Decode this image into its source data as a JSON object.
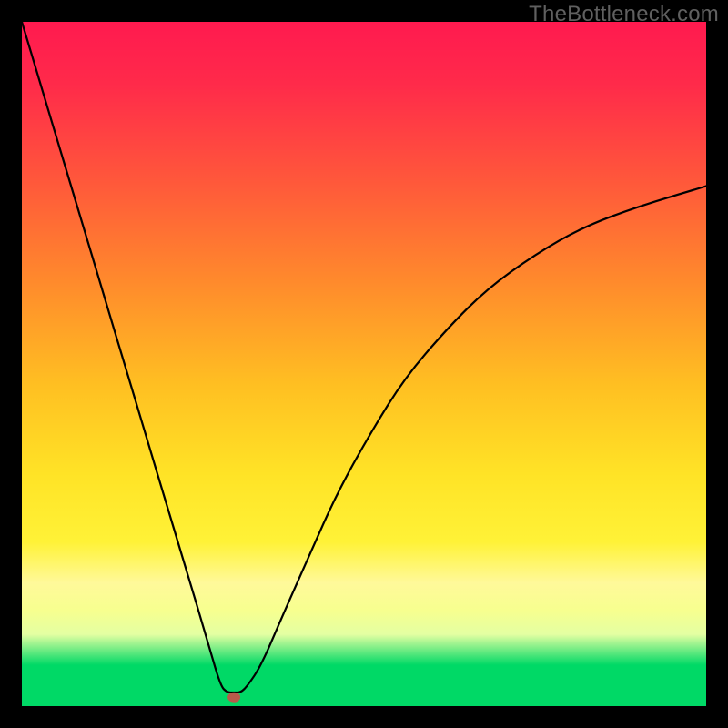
{
  "watermark": "TheBottleneck.com",
  "chart_data": {
    "type": "line",
    "title": "",
    "xlabel": "",
    "ylabel": "",
    "xlim": [
      0,
      100
    ],
    "ylim": [
      0,
      100
    ],
    "grid": false,
    "legend": false,
    "colors": {
      "curve": "#000000",
      "marker": "#b85a4a",
      "background_top": "#ff1a4f",
      "background_mid_orange": "#ff8a2c",
      "background_mid_yellow": "#ffe326",
      "background_pale_band": "#fff99a",
      "background_bottom": "#00d966"
    },
    "series": [
      {
        "name": "curve",
        "x": [
          0,
          3,
          6,
          9,
          12,
          15,
          18,
          21,
          24,
          27,
          29,
          30,
          31,
          32,
          33,
          35,
          38,
          42,
          46,
          51,
          56,
          62,
          68,
          75,
          82,
          90,
          100
        ],
        "y": [
          100,
          90,
          80,
          70,
          60,
          50,
          40,
          30,
          20,
          10,
          3,
          2,
          2,
          2,
          3,
          6,
          13,
          22,
          31,
          40,
          48,
          55,
          61,
          66,
          70,
          73,
          76
        ]
      }
    ],
    "marker": {
      "x": 31,
      "y": 1.3,
      "color": "#b85a4a"
    },
    "notes": "x and y are percent of plot width/height; y measured from bottom (0) to top (100). Values estimated from pixels — no axis labels present."
  }
}
